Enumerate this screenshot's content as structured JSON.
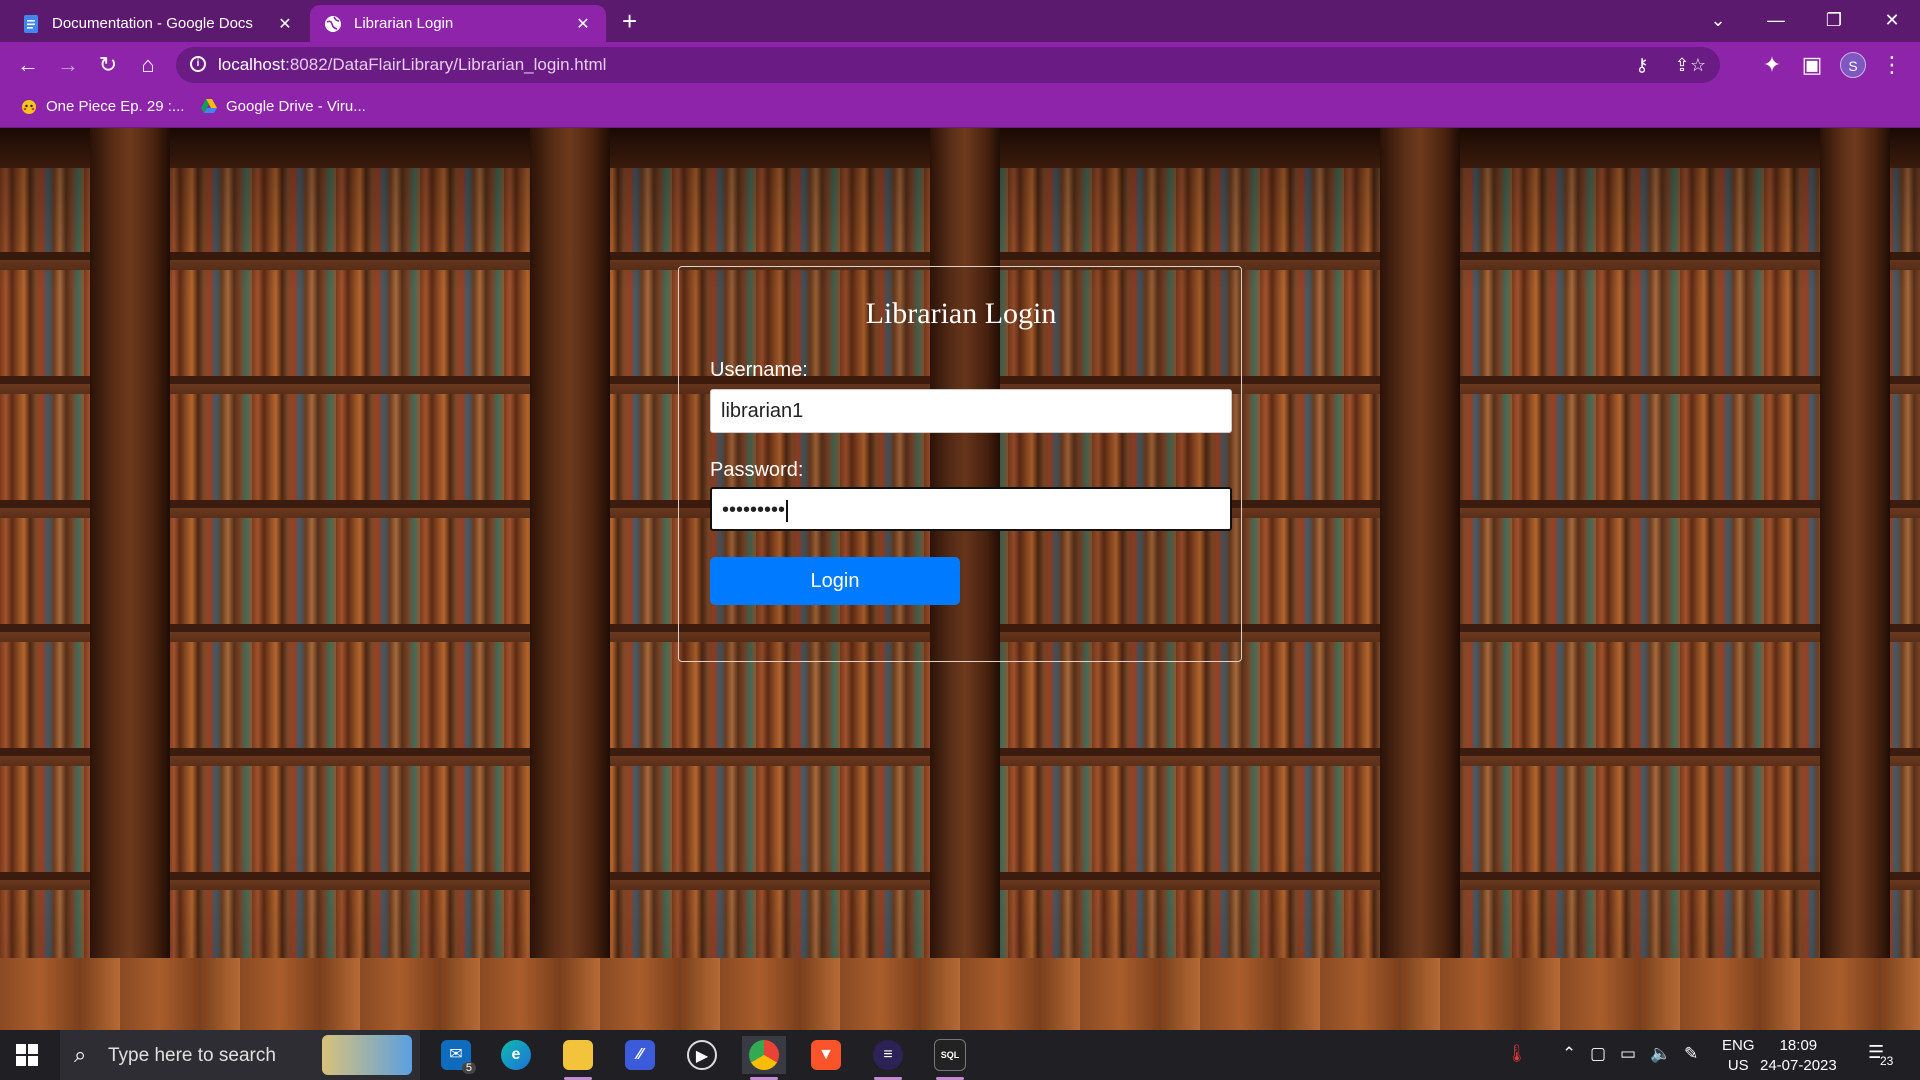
{
  "browser": {
    "tabs": [
      {
        "title": "Documentation - Google Docs",
        "active": false
      },
      {
        "title": "Librarian Login",
        "active": true
      }
    ],
    "address": {
      "host": "localhost",
      "path": ":8082/DataFlairLibrary/Librarian_login.html"
    },
    "profile_initial": "S",
    "bookmarks": [
      {
        "label": "One Piece Ep. 29 :..."
      },
      {
        "label": "Google Drive - Viru..."
      }
    ]
  },
  "login": {
    "title": "Librarian Login",
    "username_label": "Username:",
    "username_value": "librarian1",
    "password_label": "Password:",
    "password_masked": "•••••••••",
    "button_label": "Login"
  },
  "taskbar": {
    "search_placeholder": "Type here to search",
    "mail_badge": "5",
    "language": "ENG",
    "region": "US",
    "time": "18:09",
    "date": "24-07-2023",
    "notification_count": "23"
  },
  "colors": {
    "tab_strip": "#5b1a6e",
    "toolbar": "#8e24aa",
    "login_button": "#007bff",
    "taskbar": "#1f1f24"
  }
}
